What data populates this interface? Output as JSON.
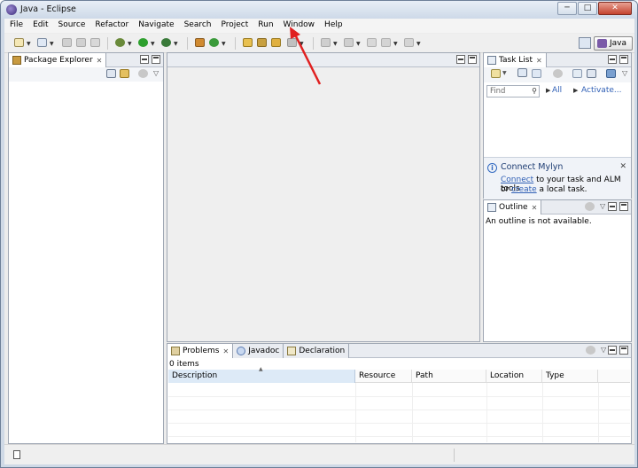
{
  "window": {
    "title": "Java - Eclipse",
    "minimize": "─",
    "maximize": "□",
    "close": "✕"
  },
  "menu": [
    "File",
    "Edit",
    "Source",
    "Refactor",
    "Navigate",
    "Search",
    "Project",
    "Run",
    "Window",
    "Help"
  ],
  "perspective": {
    "label": "Java"
  },
  "package_explorer": {
    "title": "Package Explorer"
  },
  "task_list": {
    "title": "Task List",
    "find_placeholder": "Find",
    "filter_all": "All",
    "filter_activate": "Activate..."
  },
  "mylyn": {
    "title": "Connect Mylyn",
    "connect_link": "Connect",
    "line1_rest": " to your task and ALM tools",
    "line2_prefix": "or ",
    "create_link": "create",
    "line2_rest": " a local task."
  },
  "outline": {
    "title": "Outline",
    "message": "An outline is not available."
  },
  "bottom_tabs": [
    "Problems",
    "Javadoc",
    "Declaration"
  ],
  "problems": {
    "count": "0 items",
    "columns": [
      "Description",
      "Resource",
      "Path",
      "Location",
      "Type"
    ]
  },
  "colors": {
    "annotation_arrow": "#e02020",
    "link": "#2f5fb5"
  }
}
